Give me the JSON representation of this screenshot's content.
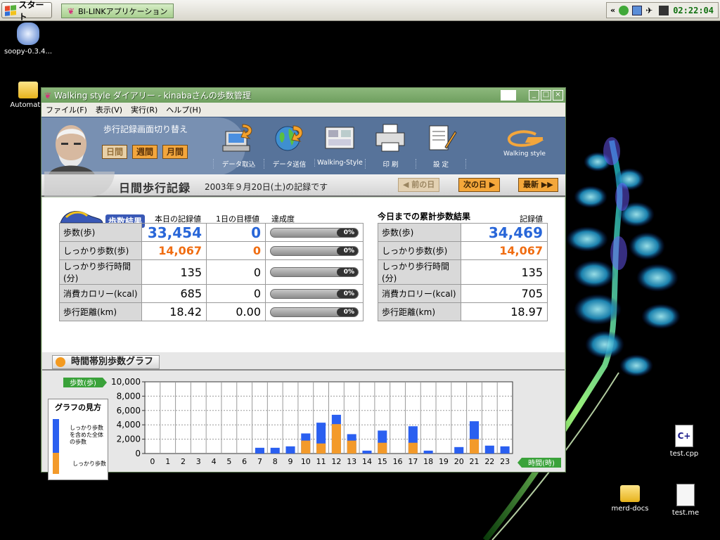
{
  "taskbar": {
    "start_label": "スタート",
    "app_label": "BI-LINKアプリケーション",
    "tray_expand": "«",
    "clock": "02:22:04"
  },
  "desktop": {
    "icons": [
      {
        "label": "soopy-0.3.4..."
      },
      {
        "label": "Automatic"
      },
      {
        "label": "test.cpp"
      },
      {
        "label": "merd-docs"
      },
      {
        "label": "test.me"
      }
    ]
  },
  "window": {
    "title": "Walking style ダイアリー - kinabaさんの歩数管理",
    "menu": [
      "ファイル(F)",
      "表示(V)",
      "実行(R)",
      "ヘルプ(H)"
    ],
    "switch_title": "歩行記録画面切り替え",
    "period_buttons": [
      "日間",
      "週間",
      "月間"
    ],
    "tools": [
      "データ取込",
      "データ送信",
      "Walking-Style",
      "印 刷",
      "設 定"
    ],
    "brand": "Walking style",
    "page_title": "日間歩行記録",
    "date_text": "2003年９月20日(土)の記録です",
    "nav": {
      "prev": "前の日",
      "next": "次の日",
      "latest": "最新"
    }
  },
  "results": {
    "badge": "歩数結果",
    "col_today": "本日の記録値",
    "col_target": "1日の目標値",
    "col_rate": "達成度",
    "rows": [
      {
        "label": "歩数(歩)",
        "today": "33,454",
        "target": "0",
        "rate": "0%"
      },
      {
        "label": "しっかり歩数(歩)",
        "today": "14,067",
        "target": "0",
        "rate": "0%"
      },
      {
        "label": "しっかり歩行時間(分)",
        "today": "135",
        "target": "0",
        "rate": "0%"
      },
      {
        "label": "消費カロリー(kcal)",
        "today": "685",
        "target": "0",
        "rate": "0%"
      },
      {
        "label": "歩行距離(km)",
        "today": "18.42",
        "target": "0.00",
        "rate": "0%"
      }
    ]
  },
  "cumulative": {
    "title": "今日までの累計歩数結果",
    "col_value": "記録値",
    "rows": [
      {
        "label": "歩数(歩)",
        "value": "34,469"
      },
      {
        "label": "しっかり歩数(歩)",
        "value": "14,067"
      },
      {
        "label": "しっかり歩行時間(分)",
        "value": "135"
      },
      {
        "label": "消費カロリー(kcal)",
        "value": "705"
      },
      {
        "label": "歩行距離(km)",
        "value": "18.97"
      }
    ]
  },
  "graph": {
    "section_title": "時間帯別歩数グラフ",
    "legend_title": "グラフの見方",
    "legend_total": "しっかり歩数を含めた全体の歩数",
    "legend_firm": "しっかり歩数",
    "colors": {
      "total": "#2a5ff0",
      "firm": "#f39a2a"
    }
  },
  "chart_data": {
    "type": "bar",
    "ylabel": "歩数(歩)",
    "xlabel": "時間(時)",
    "ylim": [
      0,
      10000
    ],
    "yticks": [
      "0",
      "2,000",
      "4,000",
      "6,000",
      "8,000",
      "10,000"
    ],
    "categories": [
      "0",
      "1",
      "2",
      "3",
      "4",
      "5",
      "6",
      "7",
      "8",
      "9",
      "10",
      "11",
      "12",
      "13",
      "14",
      "15",
      "16",
      "17",
      "18",
      "19",
      "20",
      "21",
      "22",
      "23"
    ],
    "series": [
      {
        "name": "total",
        "values": [
          0,
          0,
          0,
          0,
          0,
          0,
          0,
          800,
          800,
          1000,
          2800,
          4300,
          5400,
          2700,
          400,
          3200,
          0,
          3800,
          400,
          0,
          900,
          4500,
          1100,
          1000
        ]
      },
      {
        "name": "firm",
        "values": [
          0,
          0,
          0,
          0,
          0,
          0,
          0,
          0,
          0,
          0,
          1800,
          1400,
          4100,
          1800,
          0,
          1500,
          0,
          1500,
          0,
          0,
          0,
          2000,
          0,
          0
        ]
      }
    ]
  }
}
